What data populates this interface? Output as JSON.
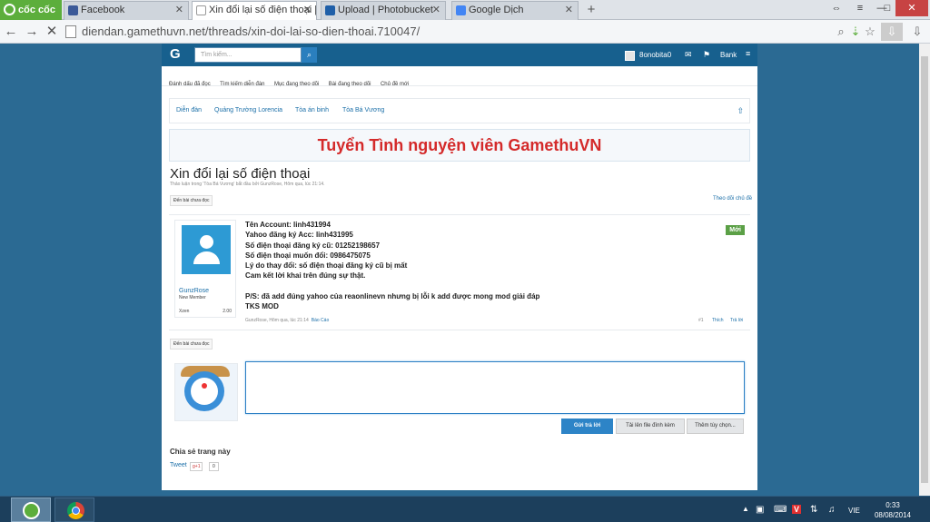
{
  "browser": {
    "brand": "cốc cốc",
    "tabs": [
      {
        "label": "Facebook",
        "icon_color": "#3b5998"
      },
      {
        "label": "Xin đổi lại số điện thoại | G",
        "icon_color": "#ffffff"
      },
      {
        "label": "Upload | Photobucket",
        "icon_color": "#1f5fa8"
      },
      {
        "label": "Google Dịch",
        "icon_color": "#4285f4"
      }
    ],
    "new_tab": "+",
    "url": "diendan.gamethuvn.net/threads/xin-doi-lai-so-dien-thoai.710047/"
  },
  "site": {
    "search_placeholder": "Tìm kiếm...",
    "logo": "G",
    "username": "8onobita0",
    "bank": "Bank",
    "subnav": [
      "Đánh dấu đã đọc",
      "Tìm kiếm diễn đàn",
      "Mục đang theo dõi",
      "Bài đang theo dõi",
      "Chủ đề mới"
    ],
    "breadcrumb": [
      "Diễn đàn",
      "Quảng Trường Lorencia",
      "Tòa án binh",
      "Tòa Bá Vương"
    ],
    "banner": "Tuyển Tình nguyện viên GamethuVN"
  },
  "thread": {
    "title": "Xin đổi lại số điện thoại",
    "meta": "Thảo luận trong 'Tòa Bá Vương' bắt đầu bởi GunzRose, Hôm qua, lúc 21:14.",
    "unread_button": "Đến bài chưa đọc",
    "follow": "Theo dõi chủ đề"
  },
  "post": {
    "author": "GunzRose",
    "author_title": "New Member",
    "xu_label": "Xzen",
    "xu_value": "2.00",
    "badge": "Mới",
    "lines": [
      "Tên Account: linh431994",
      "Yahoo đăng ký Acc: linh431995",
      "Số điện thoại đăng ký cũ: 01252198657",
      "Số điện thoại muốn đổi: 0986475075",
      "Lý do thay đổi: số điện thoại đăng ký cũ bị mất",
      "Cam kết lời khai trên đúng sự thật.",
      "",
      "P/S: đã add đúng yahoo của reaonlinevn nhưng bị lỗi k add được mong mod giải đáp",
      "TKS MOD"
    ],
    "footer": "GunzRose, Hôm qua, lúc 21:14",
    "report": "Báo Cáo",
    "number": "#1",
    "like": "Thích",
    "reply": "Trả lời"
  },
  "reply_box": {
    "send": "Gửi trả lời",
    "upload": "Tải lên file đính kèm",
    "more": "Thêm tùy chọn..."
  },
  "share": {
    "heading": "Chia sẻ trang này",
    "tweet": "Tweet",
    "gplus": "g+1",
    "gcount": "0"
  },
  "taskbar": {
    "lang": "VIE",
    "time": "0:33",
    "date": "08/08/2014"
  }
}
